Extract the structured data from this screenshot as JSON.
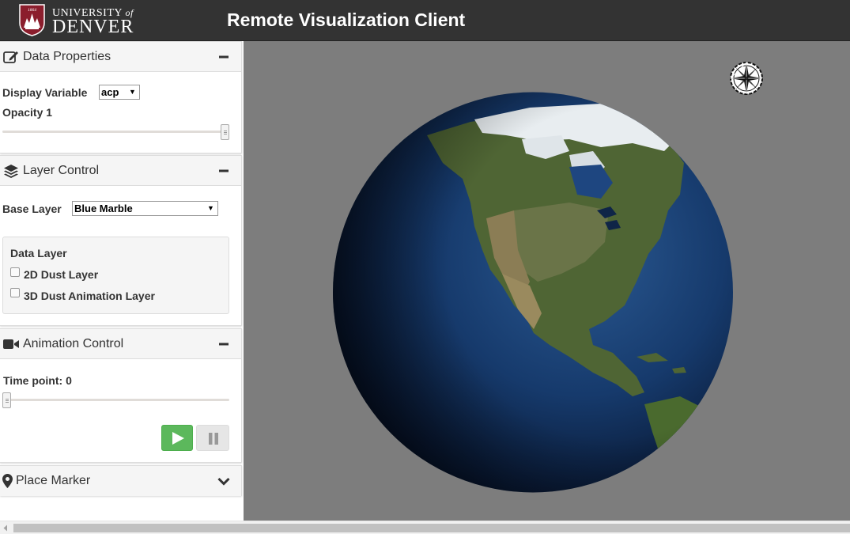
{
  "header": {
    "logo_university": "UNIVERSITY",
    "logo_of": "of",
    "logo_denver": "DENVER",
    "seal_year": "1864",
    "title": "Remote Visualization Client"
  },
  "data_properties": {
    "title": "Data Properties",
    "display_variable_label": "Display Variable",
    "display_variable_value": "acp",
    "opacity_label": "Opacity 1",
    "opacity_value": 1
  },
  "layer_control": {
    "title": "Layer Control",
    "base_layer_label": "Base Layer",
    "base_layer_value": "Blue Marble",
    "data_layer_title": "Data Layer",
    "layers": [
      {
        "label": "2D Dust Layer",
        "checked": false
      },
      {
        "label": "3D Dust Animation Layer",
        "checked": false
      }
    ]
  },
  "animation_control": {
    "title": "Animation Control",
    "time_point_label": "Time point: 0",
    "time_point_value": 0
  },
  "place_marker": {
    "title": "Place Marker"
  },
  "colors": {
    "header_bg": "#333333",
    "viewer_bg": "#7d7d7d",
    "play_button": "#5cb85c",
    "ocean": "#14305e",
    "land": "#556b34",
    "ice": "#e8edf0"
  },
  "icons": {
    "seal": "university-seal-icon",
    "data_properties": "edit-icon",
    "layer_control": "layers-icon",
    "animation_control": "video-camera-icon",
    "place_marker": "map-marker-icon",
    "collapse": "minus-icon",
    "expand": "chevron-down-icon",
    "play": "play-icon",
    "pause": "pause-icon",
    "compass": "compass-icon"
  }
}
